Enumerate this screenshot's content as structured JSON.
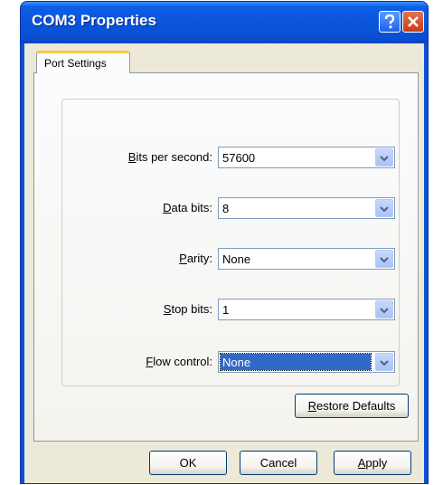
{
  "window": {
    "title": "COM3 Properties"
  },
  "tabs": [
    {
      "label": "Port Settings",
      "active": true
    }
  ],
  "settings": [
    {
      "label_mnemonic": "B",
      "label_rest": "its per second:",
      "value": "57600"
    },
    {
      "label_mnemonic": "D",
      "label_rest": "ata bits:",
      "value": "8"
    },
    {
      "label_mnemonic": "P",
      "label_rest": "arity:",
      "value": "None"
    },
    {
      "label_mnemonic": "S",
      "label_rest": "top bits:",
      "value": "1"
    },
    {
      "label_mnemonic": "F",
      "label_rest": "low control:",
      "value": "None",
      "focused": true
    }
  ],
  "buttons": {
    "restore_mnemonic": "R",
    "restore_rest": "estore Defaults",
    "ok": "OK",
    "cancel": "Cancel",
    "apply_mnemonic": "A",
    "apply_rest": "pply"
  },
  "colors": {
    "titlebar": "#0a55dc",
    "close_button": "#c53c15",
    "selection": "#316ac5",
    "client_bg": "#ece9d8"
  },
  "icons": {
    "help": "question-mark",
    "close": "x-mark",
    "dropdown": "chevron-down"
  }
}
